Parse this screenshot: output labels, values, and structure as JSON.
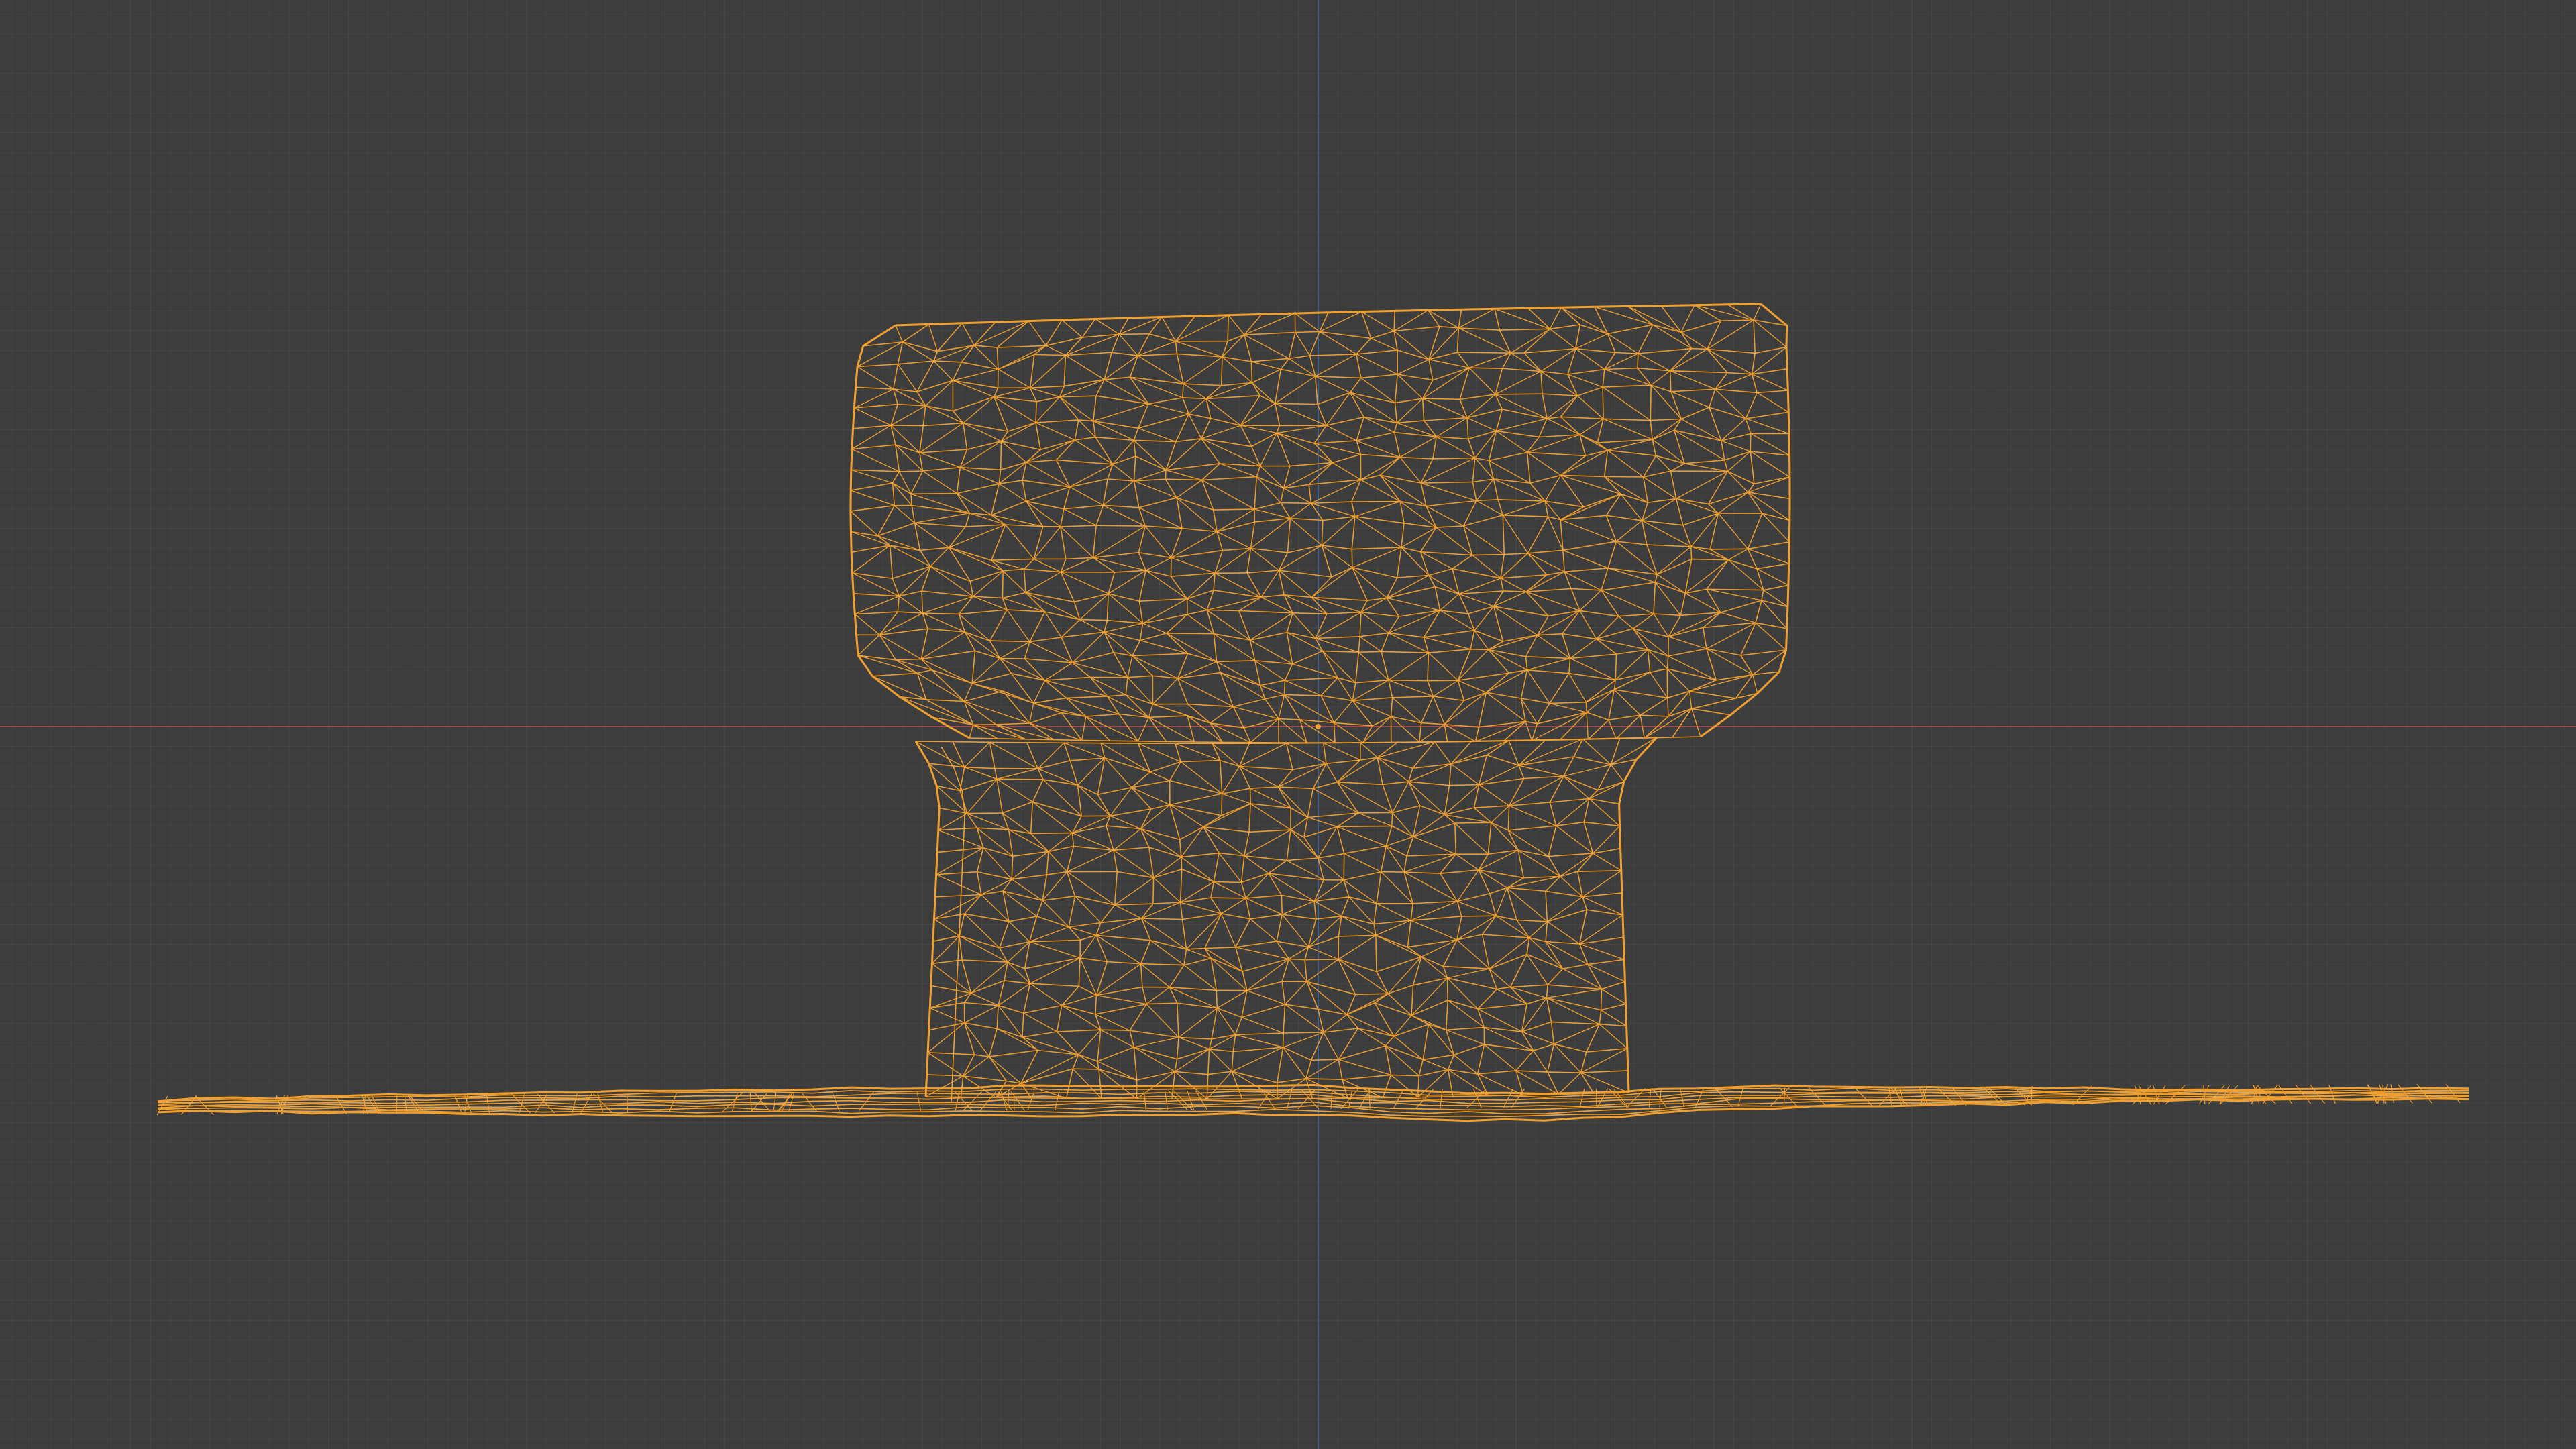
{
  "viewport": {
    "mode": "wireframe",
    "background_color": "#3d3d3d",
    "grid_minor_color": "#444444",
    "grid_major_color": "#4a4a4a",
    "x_axis_color": "#9b4a52",
    "y_axis_color": "#3f5f86",
    "wire_color": "#f0a030",
    "object_origin_color": "#f0a030"
  },
  "mesh": {
    "selected": true,
    "shape": "mushroom-shaped mesh on a thin base plane"
  }
}
